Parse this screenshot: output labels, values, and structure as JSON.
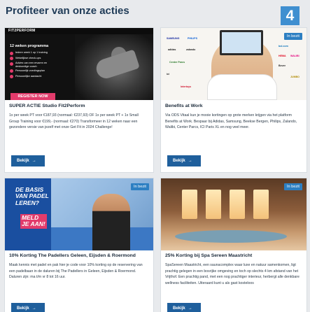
{
  "header": {
    "title": "Profiteer van onze acties",
    "step_badge": "4"
  },
  "cards": [
    {
      "title": "SUPER ACTIE Studio Fit2Perform",
      "description": "1x per week PT voor €187,93 (normaal: €237,93) OF 1x per week PT + 1x Small Group Training voor €199,- (normaal: €270) Transformeer in 12 weken naar een gezondere versie van jezelf met onze Get Fit in 2024 Challenge!",
      "button_label": "Bekijk",
      "badge": "",
      "image": {
        "logo": "FIT2PERFORM",
        "heading": "12 weken programma",
        "list": [
          "Iedere week 1 op 1 training",
          "Wekelijkse check-ups",
          "Advies van een ervaren en deskundige coach",
          "Persoonlijk voedingsplan",
          "Persoonlijke aandacht"
        ],
        "cta": "REGISTER NOW"
      }
    },
    {
      "title": "Benefits at Work",
      "description": "Via ODS Vitaal kun je mooie kortingen op grote merken krijgen via het platform Benefits at Work. Bespaar bij Adidas, Samsung, Beekse Bergen, Philips, Zalando, Walibi, Center Parcs, ICI Paris XL en nog veel meer.",
      "button_label": "Bekijk",
      "badge": "In bezit",
      "image": {
        "brands_left": [
          "SAMSUNG",
          "PHILIPS",
          "adidas",
          "zalando",
          "Center Parcs",
          "ici",
          "Intertoys"
        ],
        "brands_right": [
          "bol.com",
          "HEMA",
          "WALIBI",
          "Bever",
          "JUMBO"
        ]
      }
    },
    {
      "title": "10% Korting The Padellers Geleen, Eijsden & Roermond",
      "description": "Maak kennis met padel en pak hier je code voor 10% korting op de reservering van een padelbaan in de daluren bij The Padellers in Geleen, Eijsden & Roermond. Daluren zijn: ma t/m vr 8 tot 16 uur.",
      "button_label": "Bekijk",
      "badge": "In bezit",
      "image": {
        "headline": [
          "DE BASIS",
          "VAN PADEL",
          "LEREN?"
        ],
        "cta": [
          "MELD",
          "JE AAN!"
        ]
      }
    },
    {
      "title": "25% Korting bij Spa Sereen Maastricht",
      "description": "SpaSereen Maastricht, een saunacomplex waar luxe en natuur samenkomen, ligt prachtig gelegen in een bosrijke omgeving en toch op slechts 4 km afstand van het Vrijthof. Een prachtig pand, met een nog prachtiger interieur, herbergt alle denkbare wellness faciliteiten. Uiteraard kunt u als gast kosteloos",
      "button_label": "Bekijk",
      "badge": "In bezit",
      "image": {}
    }
  ],
  "colors": {
    "title": "#1f3b57",
    "button": "#1f5f9c",
    "badge": "#2d7fc2",
    "step_badge": "#3f8fd0",
    "accent_pink": "#e23b6b"
  }
}
